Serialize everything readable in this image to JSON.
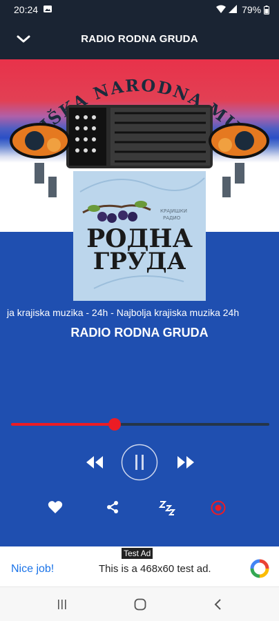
{
  "status": {
    "time": "20:24",
    "battery": "79%"
  },
  "header": {
    "title": "RADIO RODNA GRUDA"
  },
  "artwork": {
    "arc_text": "KRAJIŠKA NARODNA MUZIKA",
    "logo_line1": "РОДНА",
    "logo_line2": "ГРУДА",
    "logo_small_line1": "КРАЈИШКИ",
    "logo_small_line2": "РАДИО"
  },
  "now_playing": {
    "marquee": "ja krajiska muzika - 24h - Najbolja krajiska muzika 24h",
    "station": "RADIO RODNA GRUDA"
  },
  "player": {
    "progress": 0.4
  },
  "ad": {
    "tag": "Test Ad",
    "nice": "Nice job!",
    "text": "This is a 468x60 test ad."
  },
  "colors": {
    "bar": "#1a2433",
    "accent_red": "#ec1c24",
    "blue": "#1f4fb0"
  },
  "icons": {
    "back": "chevron-down-icon",
    "rewind": "rewind-icon",
    "play_pause": "pause-icon",
    "forward": "fast-forward-icon",
    "favorite": "heart-icon",
    "share": "share-icon",
    "sleep": "sleep-icon",
    "record": "record-icon"
  }
}
